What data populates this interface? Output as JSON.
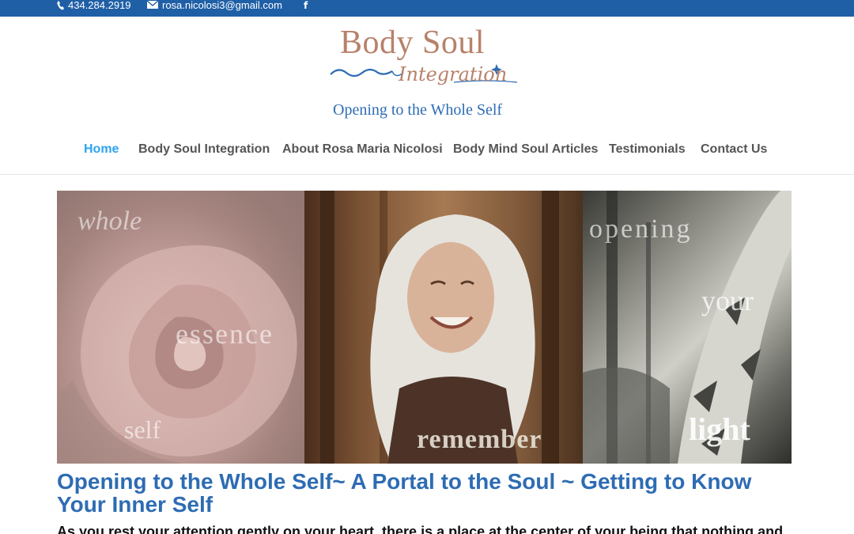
{
  "topbar": {
    "phone": "434.284.2919",
    "email": "rosa.nicolosi3@gmail.com",
    "facebook": "f"
  },
  "logo": {
    "title": "Body Soul",
    "script": "Integration",
    "tagline": "Opening to the Whole Self"
  },
  "nav": {
    "items": [
      {
        "label": "Home",
        "active": true
      },
      {
        "label": "Body Soul Integration"
      },
      {
        "label": "About Rosa Maria Nicolosi"
      },
      {
        "label": "Body Mind Soul Articles"
      },
      {
        "label": "Testimonials"
      },
      {
        "label": "Contact Us"
      }
    ]
  },
  "hero": {
    "words": {
      "whole": "whole",
      "essence": "essence",
      "self": "self",
      "remember": "remember",
      "opening": "opening",
      "your": "your",
      "light": "light"
    }
  },
  "post": {
    "title": "Opening to the Whole Self~ A Portal to the Soul ~ Getting to Know Your Inner Self",
    "body_start": "As you rest your attention gently on your heart, there is a place at the center of your being that nothing and"
  },
  "colors": {
    "topbar": "#1f5fa6",
    "accent": "#2ea3f2",
    "title_blue": "#2e6cb3",
    "logo_rose": "#b7826a"
  }
}
